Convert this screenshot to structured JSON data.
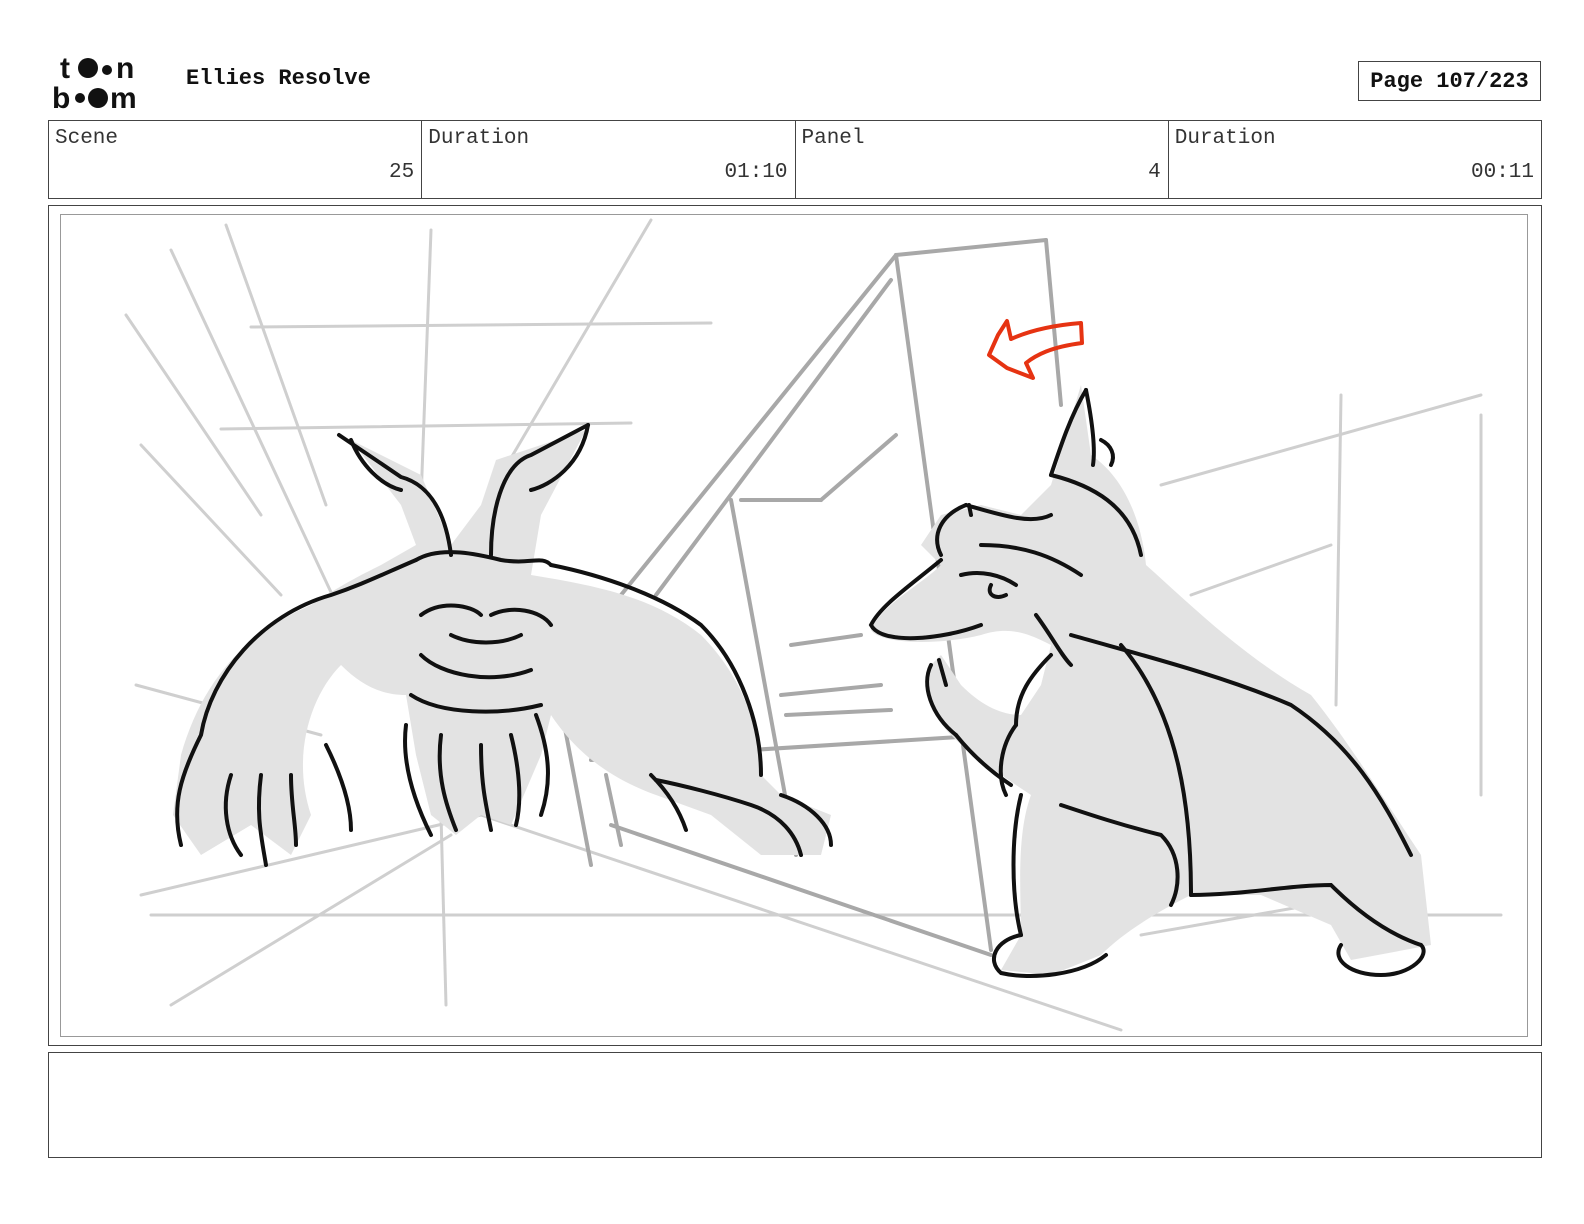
{
  "header": {
    "logo_text": "toon boom",
    "title": "Ellies Resolve",
    "page": "Page 107/223"
  },
  "info": {
    "scene_label": "Scene",
    "scene_value": "25",
    "scene_duration_label": "Duration",
    "scene_duration_value": "01:10",
    "panel_label": "Panel",
    "panel_value": "4",
    "panel_duration_label": "Duration",
    "panel_duration_value": "00:11"
  },
  "panel": {
    "illustration": "storyboard-sketch",
    "arrow_color": "#e63312",
    "figure_fill": "#e3e3e3"
  },
  "notes": {
    "text": ""
  }
}
